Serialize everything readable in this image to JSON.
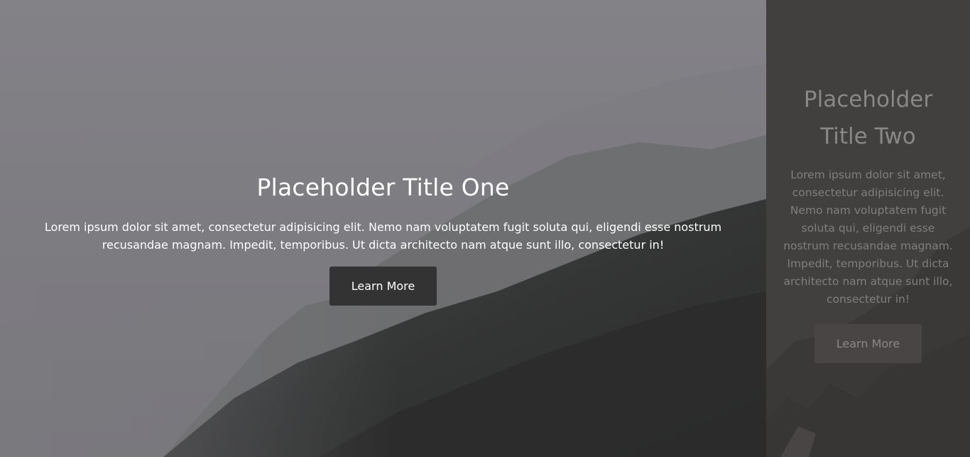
{
  "slides": [
    {
      "title": "Placeholder Title One",
      "body": "Lorem ipsum dolor sit amet, consectetur adipisicing elit. Nemo nam voluptatem fugit soluta qui, eligendi esse nostrum recusandae magnam. Impedit, temporibus. Ut dicta architecto nam atque sunt illo, consectetur in!",
      "button_label": "Learn More"
    },
    {
      "title": "Placeholder Title Two",
      "body": "Lorem ipsum dolor sit amet, consectetur adipisicing elit. Nemo nam voluptatem fugit soluta qui, eligendi esse nostrum recusandae magnam. Impedit, temporibus. Ut dicta architecto nam atque sunt illo, consectetur in!",
      "button_label": "Learn More"
    }
  ],
  "colors": {
    "button_bg": "#333333",
    "sky": "#828186",
    "mountain_dark": "#2c2c2c"
  }
}
